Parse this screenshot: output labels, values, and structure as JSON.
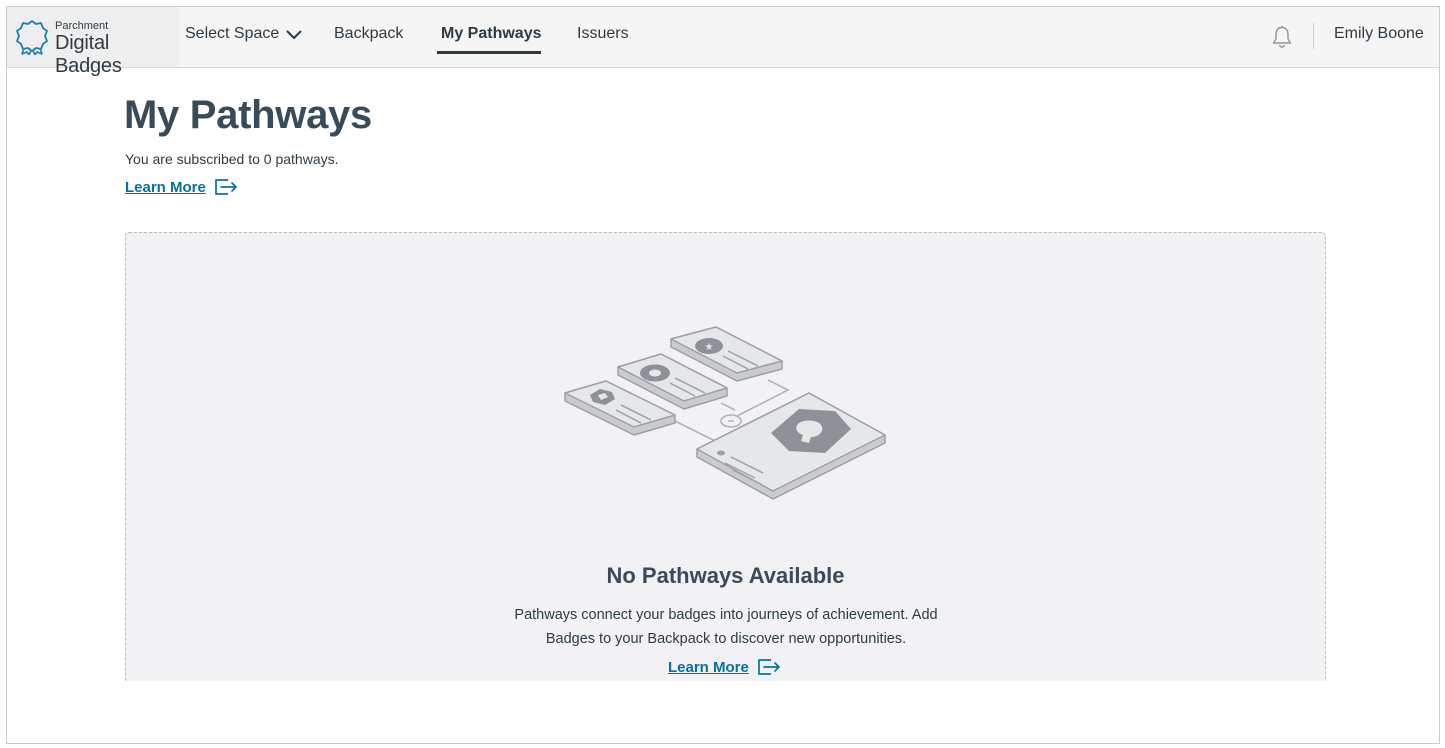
{
  "brand": {
    "small": "Parchment",
    "big": "Digital Badges",
    "logo_icon": "badge-ribbon-icon"
  },
  "nav": {
    "select_space": "Select Space",
    "select_icon": "chevron-down-icon",
    "backpack": "Backpack",
    "my_pathways": "My Pathways",
    "issuers": "Issuers",
    "active": "My Pathways"
  },
  "header_right": {
    "bell_icon": "bell-icon",
    "user_name": "Emily Boone"
  },
  "page": {
    "title": "My Pathways",
    "subscribed": "You are subscribed to 0 pathways.",
    "learn_more": "Learn More",
    "learn_more_icon": "external-link-icon"
  },
  "empty_state": {
    "illustration": "pathway-badges-illustration",
    "title": "No Pathways Available",
    "description": "Pathways connect your badges into journeys of achievement. Add Badges to your Backpack to discover new opportunities.",
    "learn_more": "Learn More"
  },
  "colors": {
    "link": "#0770a3",
    "text": "#2d3b45",
    "nav_bg": "#f5f5f5",
    "empty_bg": "#f2f2f4"
  }
}
